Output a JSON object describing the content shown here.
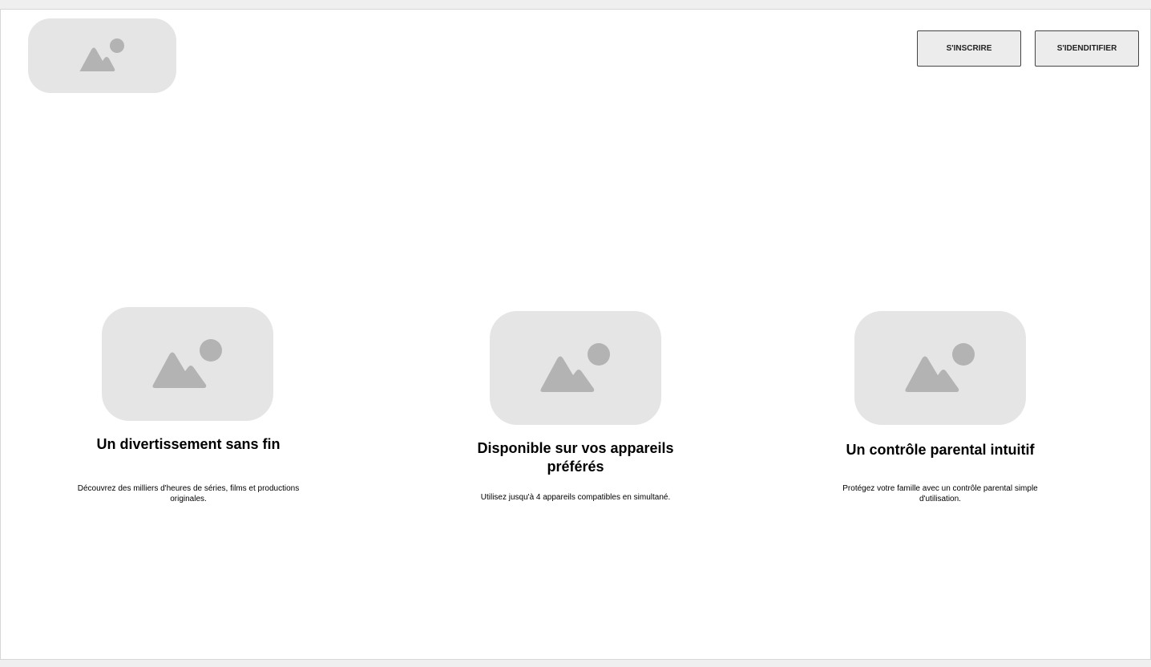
{
  "header": {
    "logo_icon": "image-placeholder-icon",
    "signup_label": "S'INSCRIRE",
    "login_label": "S'IDENDITIFIER"
  },
  "features": [
    {
      "icon": "image-placeholder-icon",
      "title": "Un divertissement sans fin",
      "text": "Découvrez des milliers d'heures de séries, films et productions originales."
    },
    {
      "icon": "image-placeholder-icon",
      "title": "Disponible sur vos appareils préférés",
      "text": "Utilisez jusqu'à 4 appareils compatibles en simultané."
    },
    {
      "icon": "image-placeholder-icon",
      "title": "Un contrôle parental intuitif",
      "text": "Protégez votre famille avec un contrôle parental simple d'utilisation."
    }
  ],
  "colors": {
    "placeholder_bg": "#e5e5e5",
    "placeholder_glyph": "#b3b3b3",
    "button_bg": "#ececec"
  }
}
